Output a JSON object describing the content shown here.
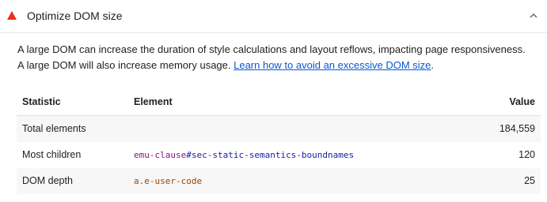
{
  "audit": {
    "title": "Optimize DOM size",
    "status_color": "#e8321e",
    "status_icon": "warning-triangle-icon",
    "toggle_icon": "chevron-up-icon"
  },
  "description": {
    "text": "A large DOM can increase the duration of style calculations and layout reflows, impacting page responsiveness. A large DOM will also increase memory usage. ",
    "link_text": "Learn how to avoid an excessive DOM size",
    "suffix": "."
  },
  "table": {
    "headers": {
      "statistic": "Statistic",
      "element": "Element",
      "value": "Value"
    },
    "rows": [
      {
        "statistic": "Total elements",
        "element_tag": "",
        "element_rest": "",
        "value": "184,559"
      },
      {
        "statistic": "Most children",
        "element_tag": "emu-clause",
        "element_rest": "#sec-static-semantics-boundnames",
        "value": "120"
      },
      {
        "statistic": "DOM depth",
        "element_tag": "a",
        "element_rest": ".e-user-code",
        "value": "25"
      }
    ]
  }
}
